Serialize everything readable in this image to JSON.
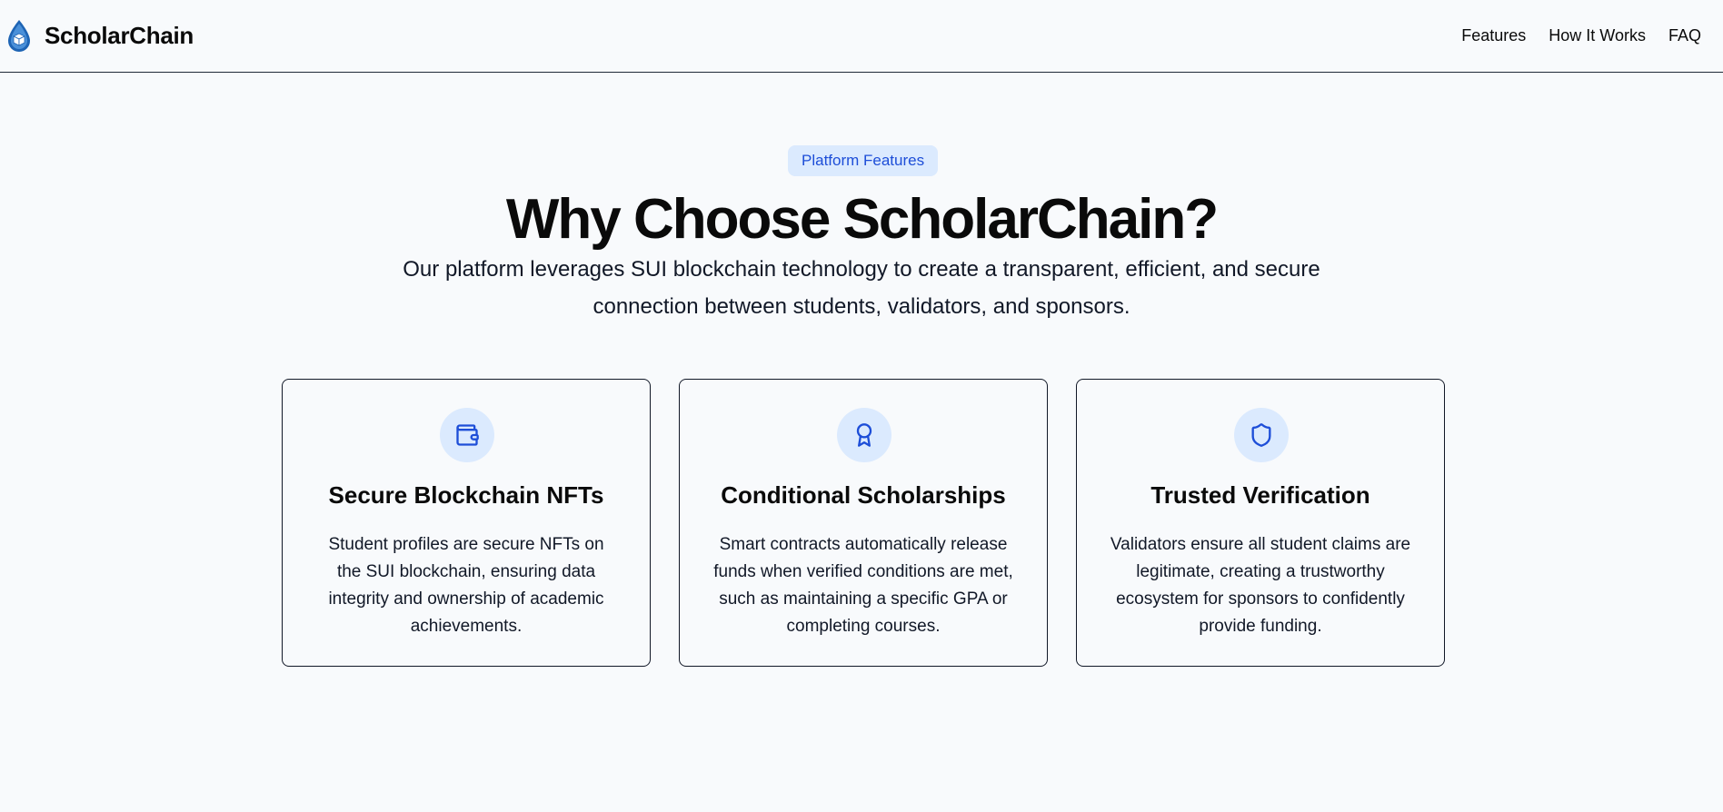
{
  "brand": {
    "name": "ScholarChain",
    "logo_icon": "droplet-logo-icon"
  },
  "nav": {
    "items": [
      {
        "label": "Features"
      },
      {
        "label": "How It Works"
      },
      {
        "label": "FAQ"
      }
    ]
  },
  "features_section": {
    "badge": "Platform Features",
    "title": "Why Choose ScholarChain?",
    "subtitle": "Our platform leverages SUI blockchain technology to create a transparent, efficient, and secure connection between students, validators, and sponsors.",
    "cards": [
      {
        "icon": "wallet-icon",
        "title": "Secure Blockchain NFTs",
        "description": "Student profiles are secure NFTs on the SUI blockchain, ensuring data integrity and ownership of academic achievements."
      },
      {
        "icon": "award-icon",
        "title": "Conditional Scholarships",
        "description": "Smart contracts automatically release funds when verified conditions are met, such as maintaining a specific GPA or completing courses."
      },
      {
        "icon": "shield-icon",
        "title": "Trusted Verification",
        "description": "Validators ensure all student claims are legitimate, creating a trustworthy ecosystem for sponsors to confidently provide funding."
      }
    ]
  },
  "colors": {
    "background": "#f8fafc",
    "accent": "#1d4ed8",
    "accent_light": "#dbeafe",
    "text": "#0a0a0a"
  }
}
